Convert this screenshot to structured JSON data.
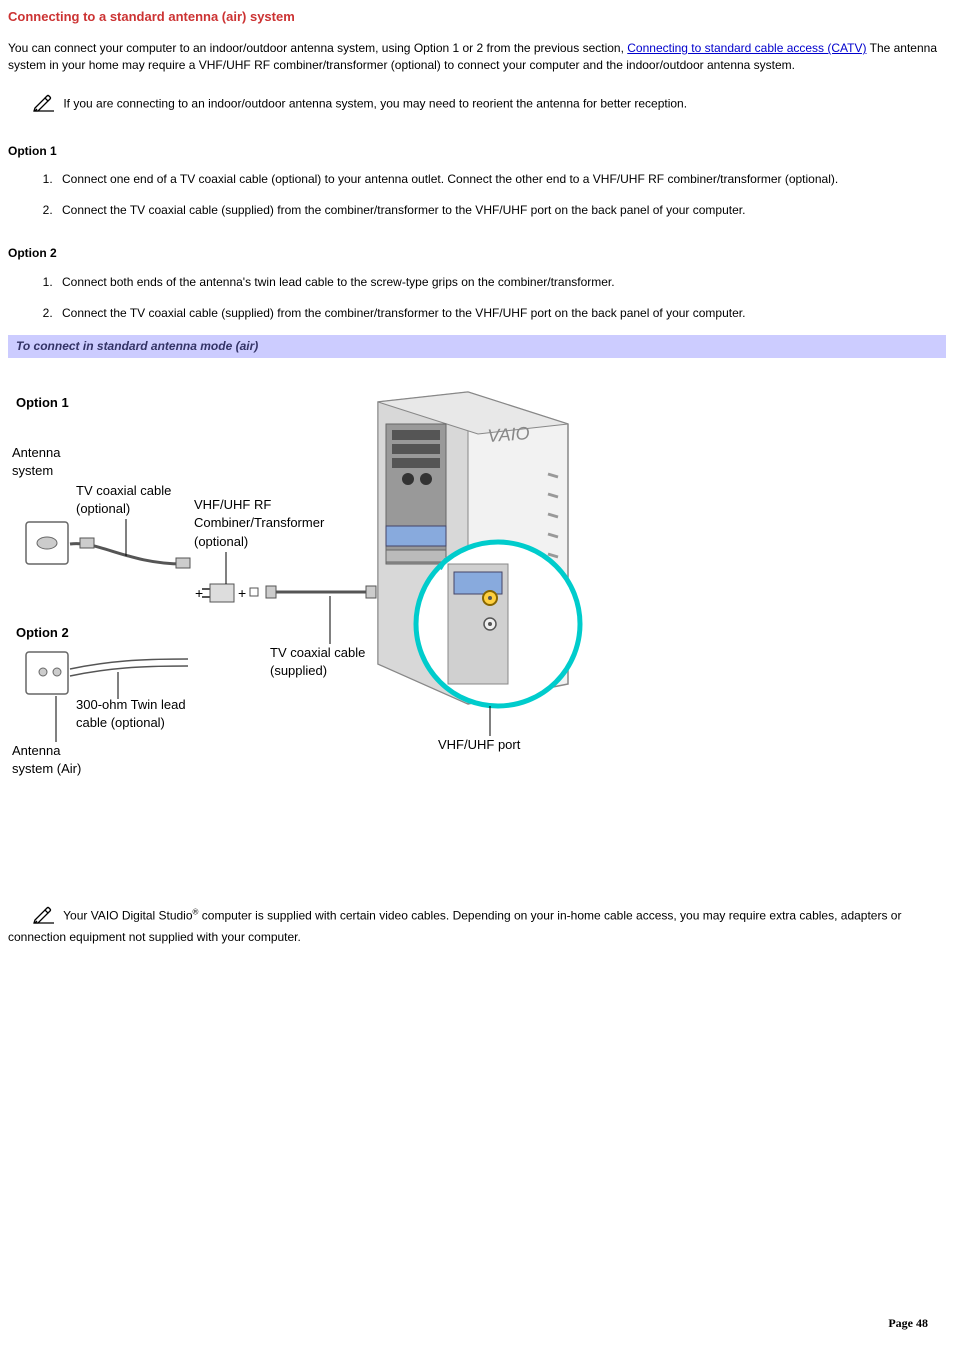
{
  "title": "Connecting to a standard antenna (air) system",
  "intro": {
    "part1": "You can connect your computer to an indoor/outdoor antenna system, using Option 1 or 2 from the previous section, ",
    "link": "Connecting to standard cable access (CATV)",
    "part2": " The antenna system in your home may require a VHF/UHF RF combiner/transformer (optional) to connect your computer and the indoor/outdoor antenna system."
  },
  "note1": " If you are connecting to an indoor/outdoor antenna system, you may need to reorient the antenna for better reception.",
  "option1": {
    "heading": "Option 1",
    "steps": [
      "Connect one end of a TV coaxial cable (optional) to your antenna outlet. Connect the other end to a VHF/UHF RF combiner/transformer (optional).",
      "Connect the TV coaxial cable (supplied) from the combiner/transformer to the VHF/UHF port on the back panel of your computer."
    ]
  },
  "option2": {
    "heading": "Option 2",
    "steps": [
      "Connect both ends of the antenna's twin lead cable to the screw-type grips on the combiner/transformer.",
      "Connect the TV coaxial cable (supplied) from the combiner/transformer to the VHF/UHF port on the back panel of your computer."
    ]
  },
  "banner": "To connect in standard antenna mode (air)",
  "diagram": {
    "opt1": "Option 1",
    "opt2": "Option 2",
    "antenna_system": "Antenna system",
    "antenna_system_air": "Antenna system (Air)",
    "tv_coax_optional": "TV coaxial cable (optional)",
    "vhf_uhf_combiner": "VHF/UHF RF Combiner/Transformer (optional)",
    "twin_lead": "300-ohm Twin lead cable (optional)",
    "tv_coax_supplied": "TV coaxial cable (supplied)",
    "vhf_uhf_port": "VHF/UHF port"
  },
  "note2_before": " Your VAIO Digital Studio",
  "note2_reg": "®",
  "note2_after": " computer is supplied with certain video cables. Depending on your in-home cable access, you may require extra cables, adapters or connection equipment not supplied with your computer.",
  "page_number": "Page 48"
}
